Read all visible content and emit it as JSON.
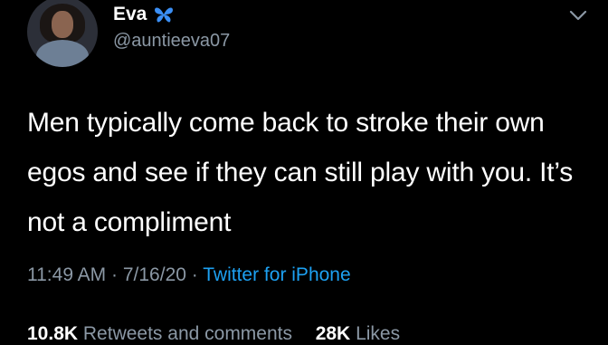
{
  "author": {
    "name": "Eva",
    "handle": "@auntieeva07",
    "verified_emoji": "butterfly-icon"
  },
  "tweet": {
    "text": "Men typically come back to stroke their own egos and see if they can still play with you. It’s not a compliment",
    "time": "11:49 AM",
    "date": "7/16/20",
    "separator": "·",
    "source": "Twitter for iPhone"
  },
  "stats": {
    "retweets_count": "10.8K",
    "retweets_label": "Retweets and comments",
    "likes_count": "28K",
    "likes_label": "Likes"
  },
  "colors": {
    "background": "#000000",
    "text": "#ffffff",
    "muted": "#8b98a5",
    "link": "#1da1f2",
    "butterfly": "#3b8ff5"
  }
}
